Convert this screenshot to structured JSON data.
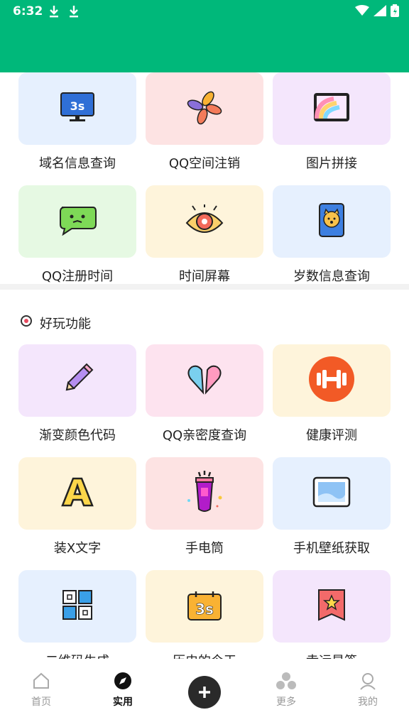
{
  "status": {
    "time": "6:32"
  },
  "colors": {
    "accent": "#00b87a"
  },
  "tools_top": [
    {
      "label": "域名信息查询",
      "icon": "monitor-3s-icon",
      "bg": "#e6f0fe"
    },
    {
      "label": "QQ空间注销",
      "icon": "pinwheel-icon",
      "bg": "#fde3e3"
    },
    {
      "label": "图片拼接",
      "icon": "rainbow-picture-icon",
      "bg": "#f4e6fc"
    },
    {
      "label": "QQ注册时间",
      "icon": "chat-bubble-face-icon",
      "bg": "#e6f9e3"
    },
    {
      "label": "时间屏幕",
      "icon": "eye-icon",
      "bg": "#fef4db"
    },
    {
      "label": "岁数信息查询",
      "icon": "dog-card-icon",
      "bg": "#e6f0fe"
    }
  ],
  "section": {
    "title": "好玩功能"
  },
  "tools_fun": [
    {
      "label": "渐变颜色代码",
      "icon": "pencil-icon",
      "bg": "#f4e6fc"
    },
    {
      "label": "QQ亲密度查询",
      "icon": "split-heart-icon",
      "bg": "#fde3ef"
    },
    {
      "label": "健康评测",
      "icon": "dumbbell-icon",
      "bg": "#fef4db"
    },
    {
      "label": "装X文字",
      "icon": "letter-a-icon",
      "bg": "#fef4db"
    },
    {
      "label": "手电筒",
      "icon": "flashlight-icon",
      "bg": "#fde3e3"
    },
    {
      "label": "手机壁纸获取",
      "icon": "wallpaper-icon",
      "bg": "#e6f0fe"
    },
    {
      "label": "二维码生成",
      "icon": "qr-code-icon",
      "bg": "#e6f0fe"
    },
    {
      "label": "历史的今天",
      "icon": "calendar-3s-icon",
      "bg": "#fef4db"
    },
    {
      "label": "幸运星签",
      "icon": "star-ribbon-icon",
      "bg": "#f4e6fc"
    }
  ],
  "nav": {
    "home": "首页",
    "tools": "实用",
    "more": "更多",
    "mine": "我的"
  }
}
